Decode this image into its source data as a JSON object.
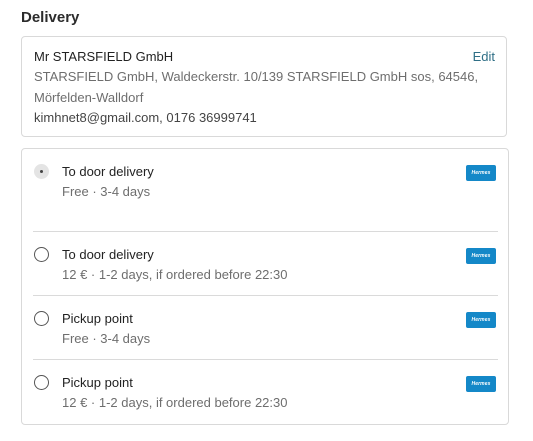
{
  "section": {
    "title": "Delivery"
  },
  "address": {
    "name": "Mr STARSFIELD GmbH",
    "edit_label": "Edit",
    "line1": "STARSFIELD GmbH, Waldeckerstr. 10/139 STARSFIELD GmbH sos, 64546,",
    "line2": "Mörfelden-Walldorf",
    "contact": "kimhnet8@gmail.com, 0176 36999741"
  },
  "options": [
    {
      "title": "To door delivery",
      "detail": "Free · 3-4 days",
      "selected": true,
      "carrier_badge": "Hermes"
    },
    {
      "title": "To door delivery",
      "detail": "12 € · 1-2 days, if ordered before 22:30",
      "selected": false,
      "carrier_badge": "Hermes"
    },
    {
      "title": "Pickup point",
      "detail": "Free · 3-4 days",
      "selected": false,
      "carrier_badge": "Hermes"
    },
    {
      "title": "Pickup point",
      "detail": "12 € · 1-2 days, if ordered before 22:30",
      "selected": false,
      "carrier_badge": "Hermes"
    }
  ],
  "colors": {
    "accent_link": "#2f6f86",
    "carrier_badge": "#1488c8",
    "border": "#d9d9d9"
  }
}
